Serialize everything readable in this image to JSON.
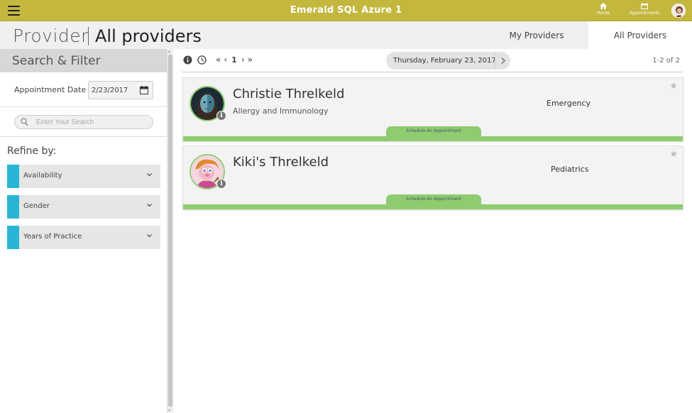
{
  "app": {
    "title": "Emerald SQL Azure 1"
  },
  "topnav": {
    "home_label": "Home",
    "appointments_label": "Appointments"
  },
  "header": {
    "breadcrumb_provider": "Provider",
    "breadcrumb_current": "All providers",
    "tabs": [
      {
        "label": "My Providers"
      },
      {
        "label": "All Providers"
      }
    ]
  },
  "sidebar": {
    "title": "Search & Filter",
    "appointment_date_label": "Appointment Date",
    "appointment_date_value": "2/23/2017",
    "search_placeholder": "Enter Your Search",
    "refine_label": "Refine by:",
    "filters": [
      {
        "label": "Availability"
      },
      {
        "label": "Gender"
      },
      {
        "label": "Years of Practice"
      }
    ]
  },
  "toolbar": {
    "pager_current": "1",
    "date": "Thursday, February 23, 2017",
    "count": "1-2 of 2"
  },
  "providers": [
    {
      "name": "Christie Threlkeld",
      "specialty": "Allergy and Immunology",
      "department": "Emergency",
      "schedule_label": "Schedule An Appointment"
    },
    {
      "name": "Kiki's Threlkeld",
      "specialty": "",
      "department": "Pediatrics",
      "schedule_label": "Schedule An Appointment"
    }
  ],
  "colors": {
    "topbar": "#c4b73e",
    "accent_blue": "#29b6d6",
    "accent_green": "#8fcb6f"
  },
  "icons": [
    "hamburger-icon",
    "home-icon",
    "calendar-icon",
    "info-icon",
    "clock-icon",
    "search-icon",
    "chevron-down-icon",
    "chevron-right-icon",
    "star-icon"
  ]
}
